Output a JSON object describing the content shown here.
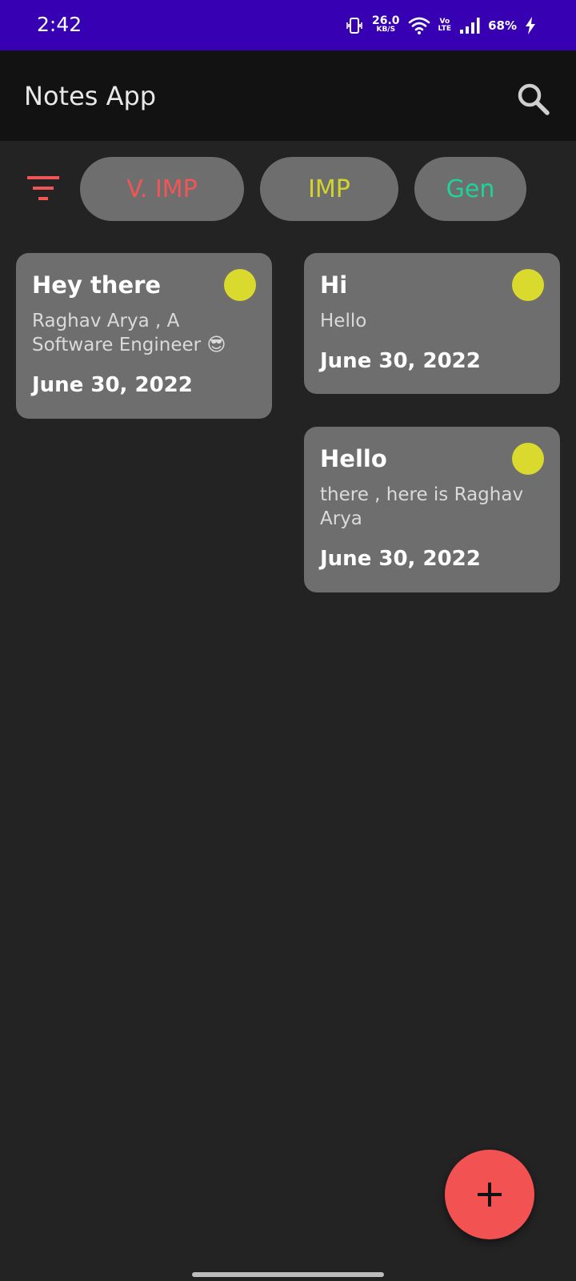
{
  "status_bar": {
    "time": "2:42",
    "net_speed_value": "26.0",
    "net_speed_unit": "KB/S",
    "volte_top": "Vo",
    "volte_bottom": "LTE",
    "battery": "68%",
    "icons": [
      "vibrate-icon",
      "wifi-icon",
      "signal-icon",
      "charging-icon"
    ]
  },
  "app_bar": {
    "title": "Notes App",
    "search_icon": "search-icon"
  },
  "filters": {
    "filter_icon": "filter-icon",
    "chips": [
      {
        "label": "V. IMP",
        "color": "#f15555"
      },
      {
        "label": "IMP",
        "color": "#d4d42e"
      },
      {
        "label": "Gen",
        "color": "#1fd29a"
      }
    ]
  },
  "notes": [
    {
      "title": "Hey there",
      "body": "Raghav Arya , A Software Engineer 😎",
      "date": "June 30, 2022",
      "priority_color": "#d9d92e"
    },
    {
      "title": "Hi",
      "body": "Hello",
      "date": "June 30, 2022",
      "priority_color": "#d9d92e"
    },
    {
      "title": "Hello",
      "body": "there , here is Raghav Arya",
      "date": "June 30, 2022",
      "priority_color": "#d9d92e"
    }
  ],
  "fab": {
    "icon": "plus-icon",
    "color": "#f25252"
  },
  "colors": {
    "status_bar": "#3700b3",
    "app_bar": "#121212",
    "background": "#232323",
    "card": "#6e6e6e"
  }
}
